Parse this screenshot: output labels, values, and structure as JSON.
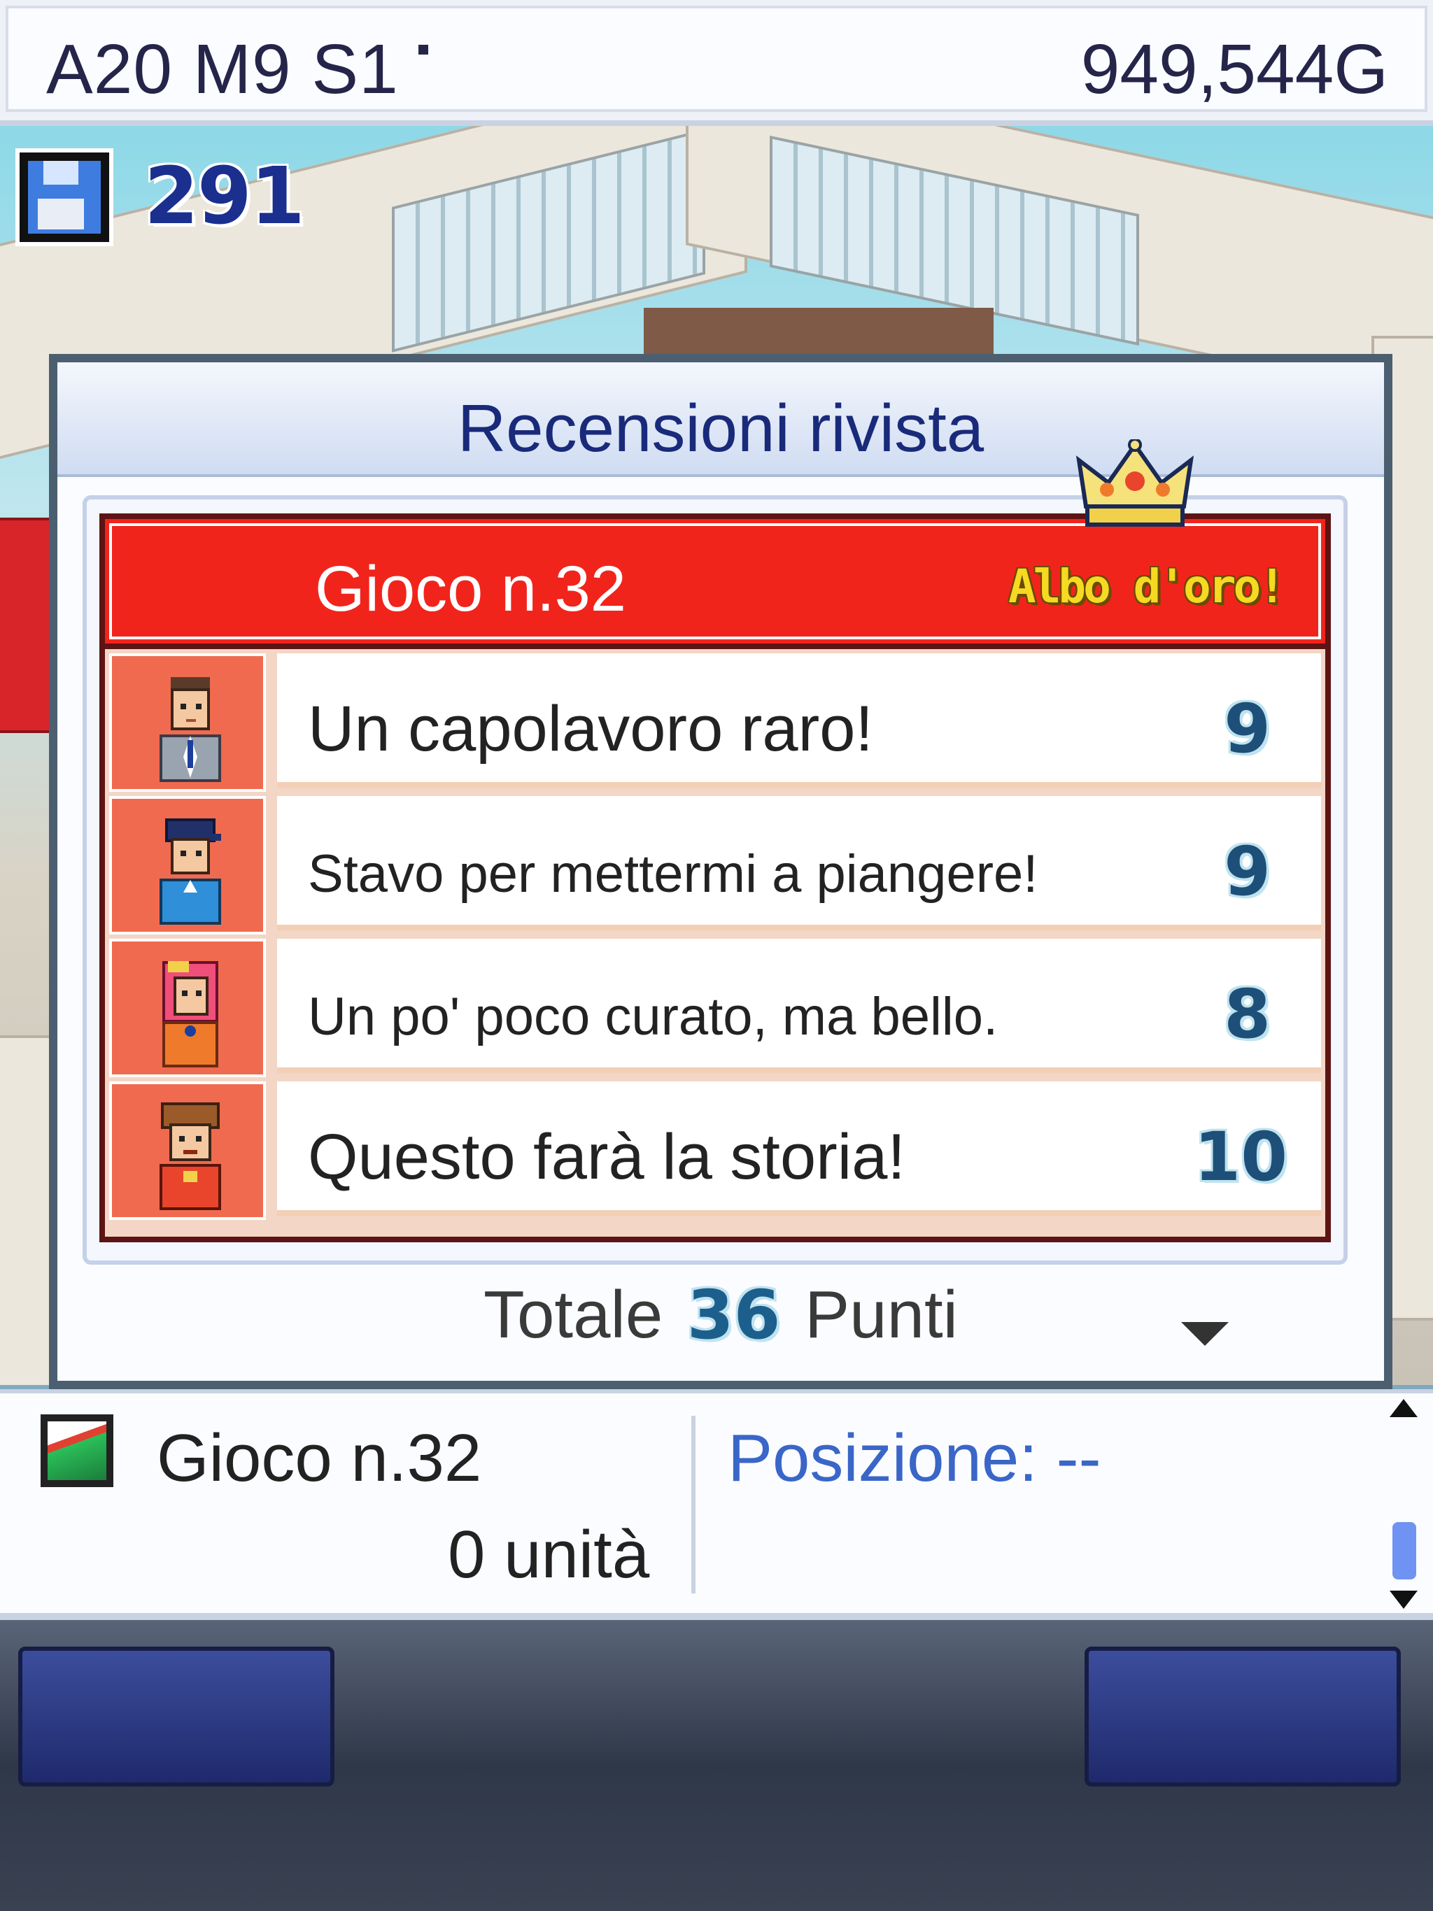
{
  "status": {
    "date": "A20 M9 S1",
    "money": "949,544G"
  },
  "save": {
    "icon": "floppy-disk-icon",
    "count": "291"
  },
  "dialog": {
    "title": "Recensioni rivista",
    "badge_icon": "crown-icon",
    "game_name": "Gioco n.32",
    "award": "Albo d'oro!",
    "reviews": [
      {
        "portrait": "reviewer-man-suit-portrait",
        "comment": "Un capolavoro raro!",
        "score": "9"
      },
      {
        "portrait": "reviewer-man-cap-portrait",
        "comment": "Stavo per mettermi a piangere!",
        "score": "9"
      },
      {
        "portrait": "reviewer-woman-pink-hair-portrait",
        "comment": "Un po' poco curato, ma bello.",
        "score": "8"
      },
      {
        "portrait": "reviewer-man-hat-portrait",
        "comment": "Questo farà la storia!",
        "score": "10"
      }
    ],
    "total_label": "Totale",
    "total_value": "36",
    "total_unit": "Punti"
  },
  "info": {
    "game_icon": "game-cartridge-icon",
    "name": "Gioco n.32",
    "units": "0 unità",
    "rank": "Posizione: --"
  }
}
